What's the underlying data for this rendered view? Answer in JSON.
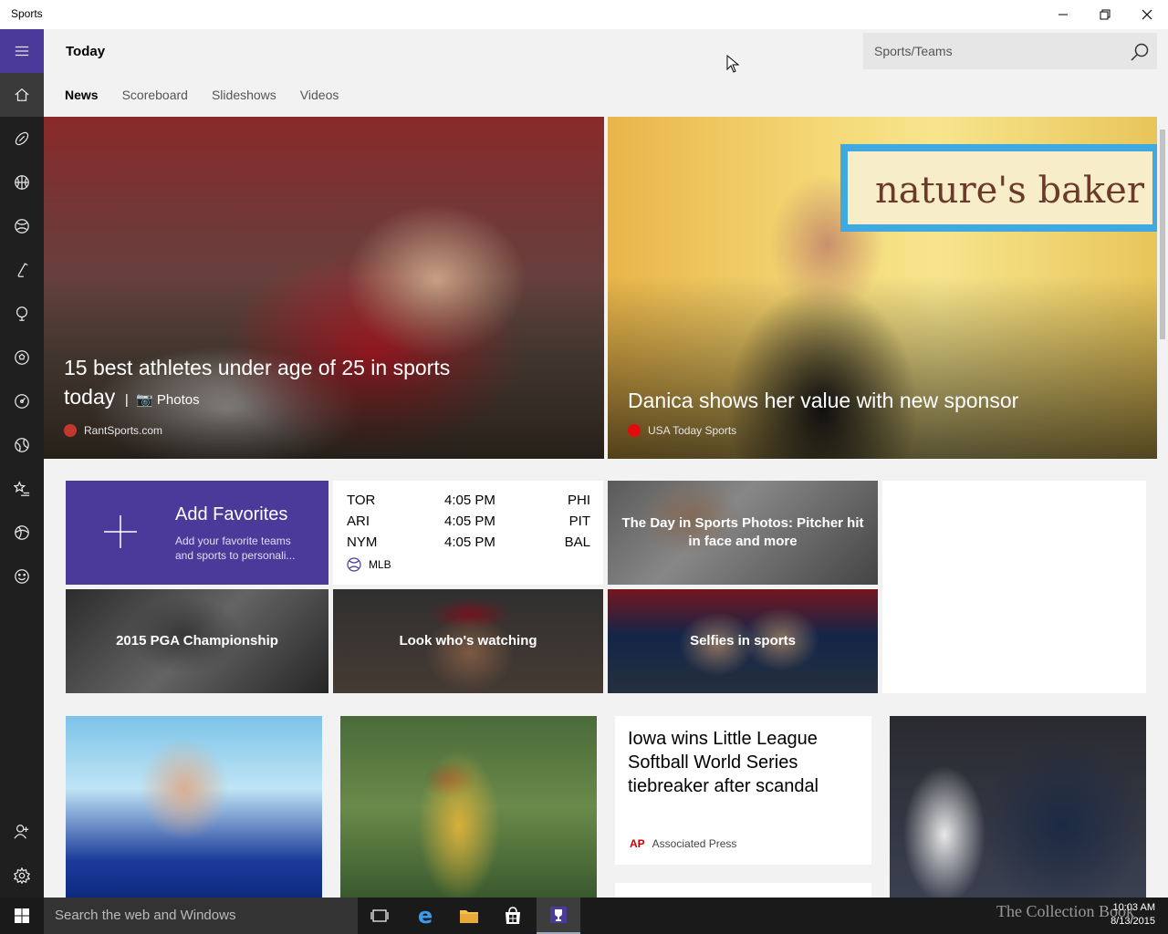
{
  "window": {
    "title": "Sports"
  },
  "header": {
    "title": "Today",
    "search_placeholder": "Sports/Teams"
  },
  "tabs": [
    {
      "label": "News",
      "active": true
    },
    {
      "label": "Scoreboard",
      "active": false
    },
    {
      "label": "Slideshows",
      "active": false
    },
    {
      "label": "Videos",
      "active": false
    }
  ],
  "hero": [
    {
      "headline": "15 best athletes under age of 25 in sports today",
      "photos_label": "Photos",
      "source": "RantSports.com",
      "source_color": "#c0392b"
    },
    {
      "headline": "Danica shows her value with new sponsor",
      "source": "USA Today Sports",
      "source_color": "#e30b0b"
    }
  ],
  "favorites": {
    "title": "Add Favorites",
    "subtitle": "Add your favorite teams and sports to personali..."
  },
  "scoreboard": {
    "games": [
      {
        "away": "TOR",
        "time": "4:05 PM",
        "home": "PHI"
      },
      {
        "away": "ARI",
        "time": "4:05 PM",
        "home": "PIT"
      },
      {
        "away": "NYM",
        "time": "4:05 PM",
        "home": "BAL"
      }
    ],
    "league": "MLB"
  },
  "tiles": {
    "day_in_sports": "The Day in Sports Photos: Pitcher hit in face and more",
    "pga": "2015 PGA Championship",
    "watching": "Look who's watching",
    "selfies": "Selfies in sports"
  },
  "article_card": {
    "title": "Iowa wins Little League Softball World Series tiebreaker after scandal",
    "source": "Associated Press"
  },
  "taskbar": {
    "search_placeholder": "Search the web and Windows",
    "time": "10:03 AM",
    "date": "8/13/2015",
    "watermark": "The Collection Book"
  },
  "colors": {
    "accent": "#4b3a9a",
    "rail": "#1f1f1f",
    "taskbar": "#1a1a1a"
  }
}
